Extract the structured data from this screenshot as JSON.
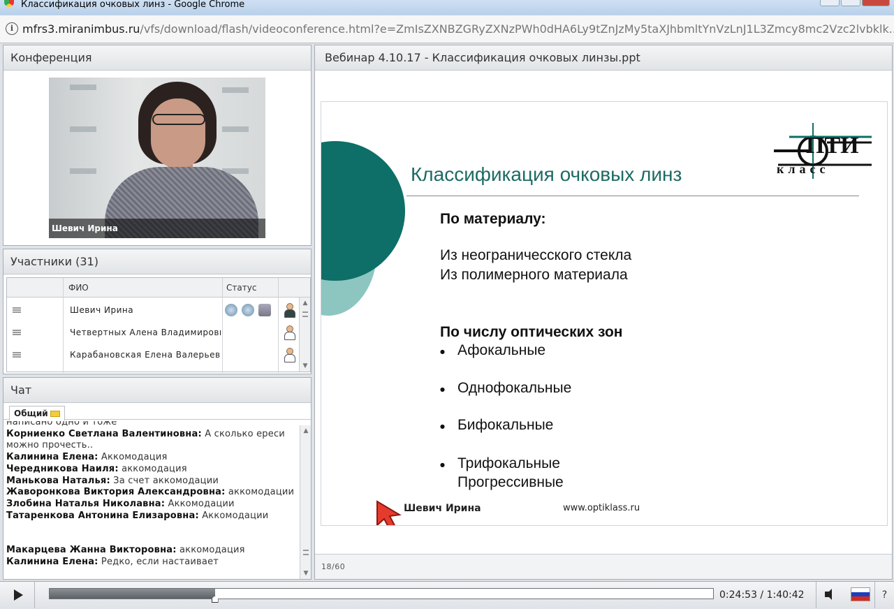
{
  "window": {
    "title": "Классификация очковых линз - Google Chrome",
    "url_host": "mfrs3.miranimbus.ru",
    "url_path": "/vfs/download/flash/videoconference.html?e=ZmIsZXNBZGRyZXNzPWh0dHA6Ly9tZnJzMy5taXJhbmltYnVzLnJ1L3Zmcy8mc2Vzc2lvbklk..."
  },
  "conference": {
    "header": "Конференция",
    "speaker_name": "Шевич Ирина"
  },
  "participants": {
    "header": "Участники (31)",
    "col_fio": "ФИО",
    "col_status": "Статус",
    "rows": [
      {
        "name": "Шевич Ирина"
      },
      {
        "name": "Четвертных Алена Владимировна"
      },
      {
        "name": "Карабановская Елена Валерьевна"
      }
    ]
  },
  "chat": {
    "header": "Чат",
    "tab": "Общий",
    "messages": [
      {
        "author": "",
        "text": "написано одно и тоже"
      },
      {
        "author": "Корниенко  Светлана  Валентиновна:",
        "text": " А сколько ереси можно прочесть.."
      },
      {
        "author": "Калинина Елена:",
        "text": " Аккомодация"
      },
      {
        "author": "Чередникова Наиля:",
        "text": " аккомодация"
      },
      {
        "author": "Манькова Наталья:",
        "text": " За счет аккомодации"
      },
      {
        "author": "Жаворонкова Виктория Александровна:",
        "text": " аккомодации"
      },
      {
        "author": "Злобина Наталья Николавна:",
        "text": " Аккомодации"
      },
      {
        "author": "Татаренкова Антонина  Елизаровна:",
        "text": " Аккомодации"
      }
    ],
    "messages_after_gap": [
      {
        "author": "Макарцева Жанна Викторовна:",
        "text": " аккомодация"
      },
      {
        "author": "Калинина Елена:",
        "text": " Редко, если настаивает"
      }
    ]
  },
  "presentation": {
    "header": "Вебинар 4.10.17 - Классификация очковых линзы.ppt",
    "page_indicator": "18/60",
    "slide": {
      "logo_text": "ПТИ",
      "logo_sub": "класс",
      "title": "Классификация очковых линз",
      "section1_heading": "По материалу",
      "section1_items": [
        "Из неограничесского стекла",
        "Из полимерного материала"
      ],
      "section2_heading": "По числу оптических зон",
      "bullets": [
        "Афокальные",
        "Однофокальные",
        "Бифокальные",
        "Трифокальные"
      ],
      "extra_line": "Прогрессивные",
      "author": "Шевич Ирина",
      "website": "www.optiklass.ru"
    }
  },
  "player": {
    "time": "0:24:53 / 1:40:42",
    "progress": 0.249,
    "help": "?"
  }
}
